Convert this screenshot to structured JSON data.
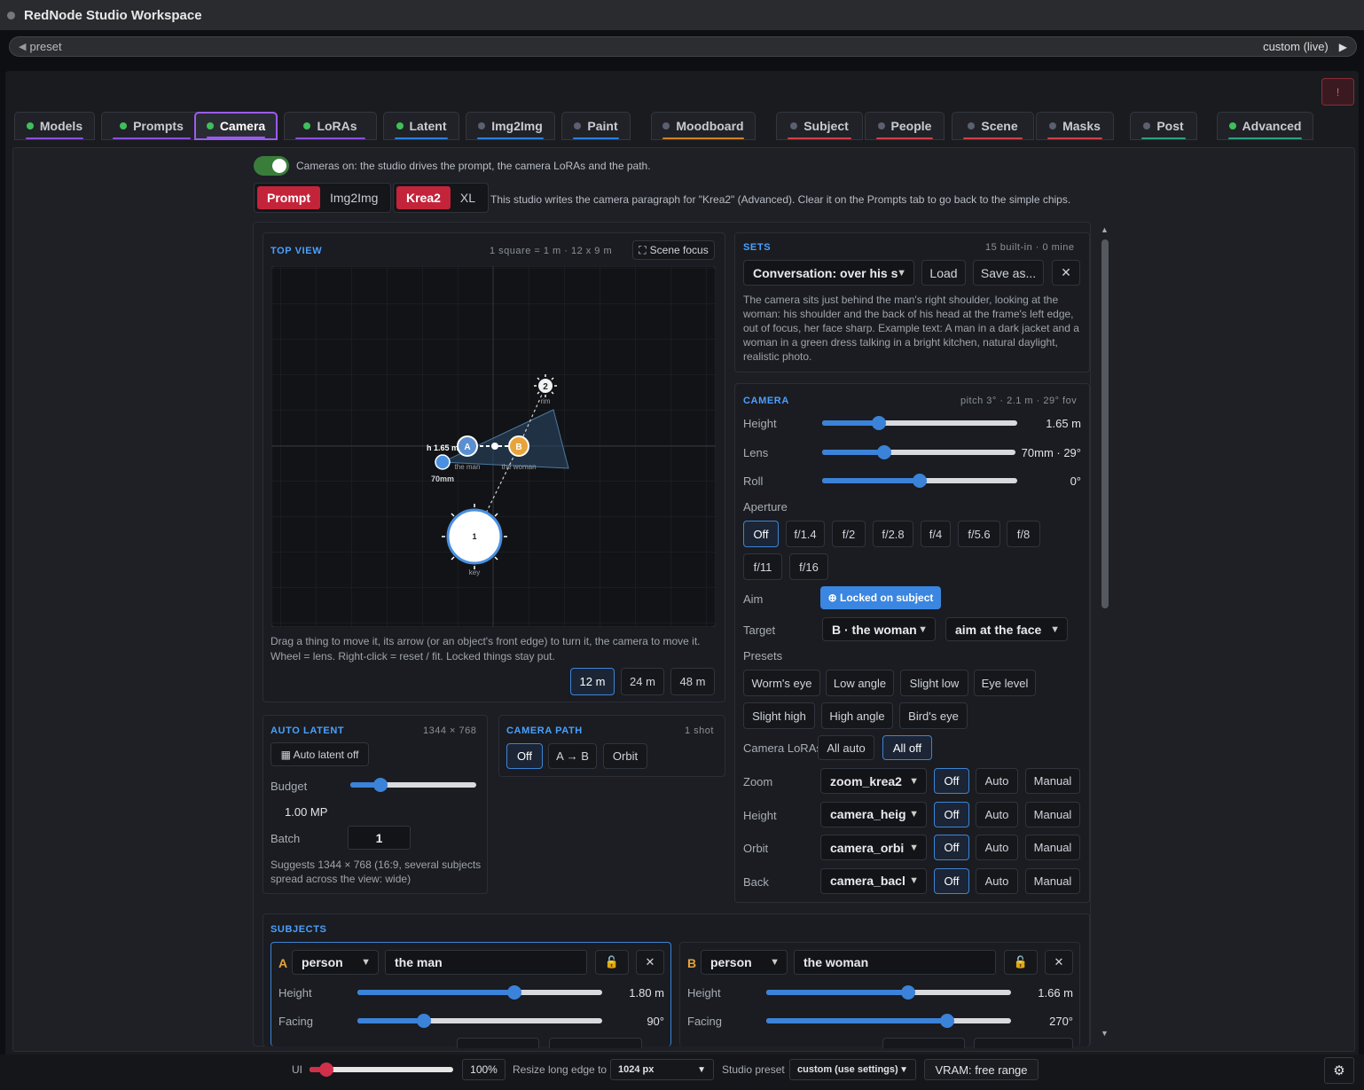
{
  "window": {
    "title": "RedNode Studio Workspace"
  },
  "preset_bar": {
    "label": "preset",
    "value": "custom (live)"
  },
  "alert_label": "!",
  "tabs": [
    {
      "label": "Models",
      "dot": "#3fbf5a",
      "ul": "#8a4fe0"
    },
    {
      "label": "Prompts",
      "dot": "#3fbf5a",
      "ul": "#8a4fe0"
    },
    {
      "label": "Camera",
      "dot": "#3fbf5a",
      "ul": "#9a5cf0"
    },
    {
      "label": "LoRAs",
      "dot": "#3fbf5a",
      "ul": "#8a4fe0"
    },
    {
      "label": "Latent",
      "dot": "#3fbf5a",
      "ul": "#2a7fe0"
    },
    {
      "label": "Img2Img",
      "dot": "#5a6070",
      "ul": "#2a7fe0"
    },
    {
      "label": "Paint",
      "dot": "#5a6070",
      "ul": "#2a7fe0"
    },
    {
      "label": "Moodboard",
      "dot": "#5a6070",
      "ul": "#d08020"
    },
    {
      "label": "Subject",
      "dot": "#5a6070",
      "ul": "#d0404a"
    },
    {
      "label": "People",
      "dot": "#5a6070",
      "ul": "#d0404a"
    },
    {
      "label": "Scene",
      "dot": "#5a6070",
      "ul": "#d0404a"
    },
    {
      "label": "Masks",
      "dot": "#5a6070",
      "ul": "#d0404a"
    },
    {
      "label": "Post",
      "dot": "#5a6070",
      "ul": "#2aa07f"
    },
    {
      "label": "Advanced",
      "dot": "#3fbf5a",
      "ul": "#2aa07f"
    }
  ],
  "camera_toggle": {
    "label": "Cameras on: the studio drives the prompt, the camera LoRAs and the path."
  },
  "mode_seg": {
    "a": "Prompt",
    "b": "Img2Img"
  },
  "model_seg": {
    "a": "Krea2",
    "b": "XL"
  },
  "model_note": "This studio writes the camera paragraph for \"Krea2\" (Advanced). Clear it on the Prompts tab to go back to the simple chips.",
  "top_view": {
    "title": "TOP VIEW",
    "meta": "1 square = 1 m · 12 x 9 m",
    "focus_button": "Scene focus",
    "labels": {
      "cam_height": "h 1.65 m",
      "lens": "70mm",
      "a": "A",
      "b": "B",
      "man": "the man",
      "woman": "the woman",
      "rim": "rim",
      "rim_num": "2",
      "key": "key",
      "key_num": "1"
    },
    "help": "Drag a thing to move it, its arrow (or an object's front edge) to turn it, the camera to move it.",
    "help2": "Wheel = lens. Right-click = reset / fit. Locked things stay put.",
    "scales": [
      "12 m",
      "24 m",
      "48 m"
    ]
  },
  "sets": {
    "title": "SETS",
    "meta": "15 built-in · 0 mine",
    "selected": "Conversation: over his s",
    "load": "Load",
    "save": "Save as...",
    "close": "✕",
    "description": "The camera sits just behind the man's right shoulder, looking at the woman: his shoulder and the back of his head at the frame's left edge, out of focus, her face sharp. Example text: A man in a dark jacket and a woman in a green dress talking in a bright kitchen, natural daylight, realistic photo."
  },
  "camera": {
    "title": "CAMERA",
    "meta": "pitch 3° · 2.1 m · 29° fov",
    "height_label": "Height",
    "height_value": "1.65 m",
    "height_frac": 0.29,
    "lens_label": "Lens",
    "lens_value": "70mm · 29°",
    "lens_frac": 0.32,
    "roll_label": "Roll",
    "roll_value": "0°",
    "roll_frac": 0.5,
    "aperture_label": "Aperture",
    "apertures": [
      "Off",
      "f/1.4",
      "f/2",
      "f/2.8",
      "f/4",
      "f/5.6",
      "f/8",
      "f/11",
      "f/16"
    ],
    "aim_label": "Aim",
    "aim_value": "⊕ Locked on subject",
    "target_label": "Target",
    "target_value": "B · the woman",
    "target_mode": "aim at the face",
    "presets_label": "Presets",
    "presets": [
      "Worm's eye",
      "Low angle",
      "Slight low",
      "Eye level",
      "Slight high",
      "High angle",
      "Bird's eye"
    ],
    "loras_label": "Camera LoRAs",
    "loras_all_auto": "All auto",
    "loras_all_off": "All off",
    "lora_rows": [
      {
        "label": "Zoom",
        "select": "zoom_krea2"
      },
      {
        "label": "Height",
        "select": "camera_heig"
      },
      {
        "label": "Orbit",
        "select": "camera_orbi"
      },
      {
        "label": "Back",
        "select": "camera_bacl"
      }
    ],
    "lora_modes": [
      "Off",
      "Auto",
      "Manual"
    ]
  },
  "auto_latent": {
    "title": "AUTO LATENT",
    "meta": "1344 × 768",
    "button": "▦ Auto latent off",
    "budget_label": "Budget",
    "budget_value": "1.00 MP",
    "budget_frac": 0.24,
    "batch_label": "Batch",
    "batch_value": "1",
    "suggest": "Suggests 1344 × 768 (16:9, several subjects spread across the view: wide)"
  },
  "camera_path": {
    "title": "CAMERA PATH",
    "meta": "1 shot",
    "options": [
      "Off",
      "A → B",
      "Orbit"
    ]
  },
  "subjects": {
    "title": "SUBJECTS",
    "items": [
      {
        "letter": "A",
        "type": "person",
        "name": "the man",
        "height_label": "Height",
        "height_value": "1.80 m",
        "height_frac": 0.64,
        "facing_label": "Facing",
        "facing_value": "90°",
        "facing_frac": 0.27
      },
      {
        "letter": "B",
        "type": "person",
        "name": "the woman",
        "height_label": "Height",
        "height_value": "1.66 m",
        "height_frac": 0.58,
        "facing_label": "Facing",
        "facing_value": "270°",
        "facing_frac": 0.74
      }
    ]
  },
  "bottom": {
    "ui_label": "UI",
    "ui_frac": 0.12,
    "ui_value": "100%",
    "resize_label": "Resize long edge to",
    "resize_value": "1024 px",
    "studio_label": "Studio preset",
    "studio_value": "custom (use settings)",
    "vram": "VRAM: free range"
  }
}
